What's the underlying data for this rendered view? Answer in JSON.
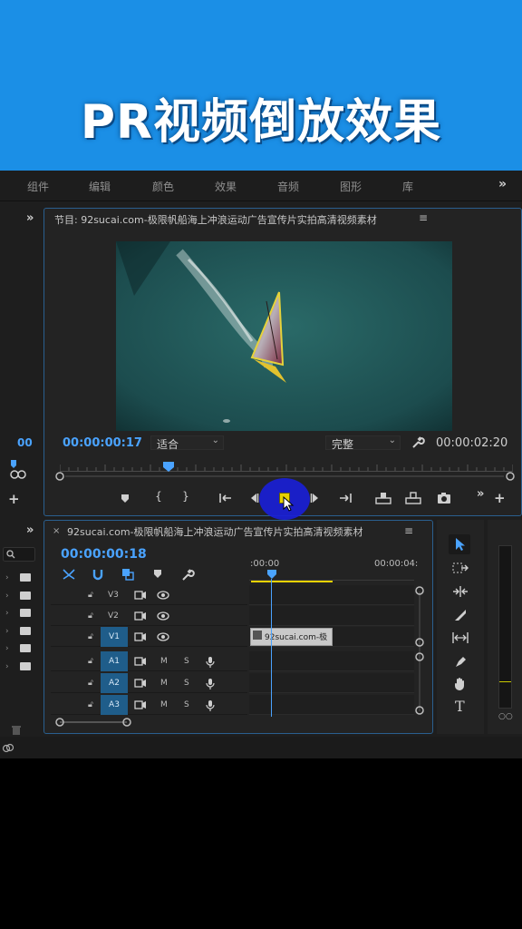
{
  "banner": {
    "title": "PR视频倒放效果"
  },
  "menu": {
    "items": [
      "组件",
      "编辑",
      "颜色",
      "效果",
      "音频",
      "图形",
      "库"
    ],
    "more": "»"
  },
  "monitor": {
    "panel_expand": "»",
    "title": "节目: 92sucai.com-极限帆船海上冲浪运动广告宣传片实拍高清视频素材",
    "menu_icon": "≡",
    "left_timecode": "00",
    "current_timecode": "00:00:00:17",
    "fit_value": "适合",
    "quality_value": "完整",
    "duration_timecode": "00:00:02:20",
    "playhead_fraction": 0.24,
    "icons": [
      "marker-icon",
      "mark-in-icon",
      "mark-out-icon",
      "go-to-in-icon",
      "step-back-icon",
      "play-icon",
      "step-forward-icon",
      "go-to-out-icon",
      "lift-icon",
      "extract-icon",
      "export-frame-icon"
    ],
    "add": "+",
    "more": "»"
  },
  "timeline": {
    "panel_expand": "»",
    "close": "×",
    "sequence_name": "92sucai.com-极限帆船海上冲浪运动广告宣传片实拍高清视频素材",
    "menu_icon": "≡",
    "current_timecode": "00:00:00:18",
    "ruler_start": ":00:00",
    "ruler_end": "00:00:04:",
    "video_tracks": [
      "V3",
      "V2",
      "V1"
    ],
    "audio_tracks": [
      "A1",
      "A2",
      "A3"
    ],
    "source_patch_v": "V1",
    "mute_label": "M",
    "solo_label": "S",
    "clip_name": "92sucai.com-极"
  },
  "colors": {
    "accent_blue": "#4aa3ff",
    "banner_blue": "#1b8fe6",
    "panel_border": "#2a5f8f",
    "play_yellow": "#e8d200",
    "highlight_circle": "#1a1fd6"
  }
}
